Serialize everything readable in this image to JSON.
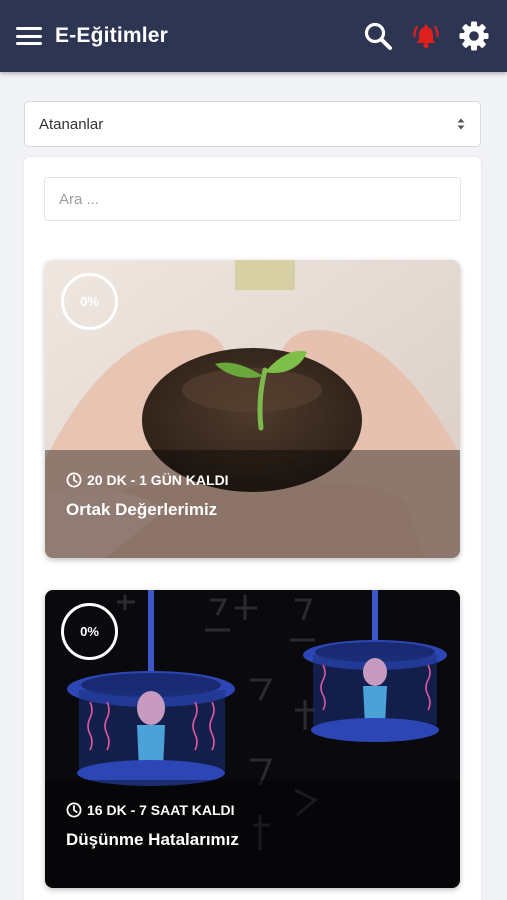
{
  "appbar": {
    "title": "E-Eğitimler"
  },
  "filter": {
    "selected": "Atananlar"
  },
  "search": {
    "placeholder": "Ara ..."
  },
  "courses": [
    {
      "progress": "0%",
      "progress_value": 0,
      "meta": "20 DK - 1 GÜN KALDI",
      "title": "Ortak Değerlerimiz"
    },
    {
      "progress": "0%",
      "progress_value": 0,
      "meta": "16 DK - 7 SAAT KALDI",
      "title": "Düşünme Hatalarımız"
    }
  ],
  "colors": {
    "appbar": "#2e3553",
    "bell": "#e01e1e",
    "background": "#f2f3f7"
  },
  "icons": [
    "menu-icon",
    "search-icon",
    "bell-alert-icon",
    "gear-icon",
    "clock-icon"
  ]
}
